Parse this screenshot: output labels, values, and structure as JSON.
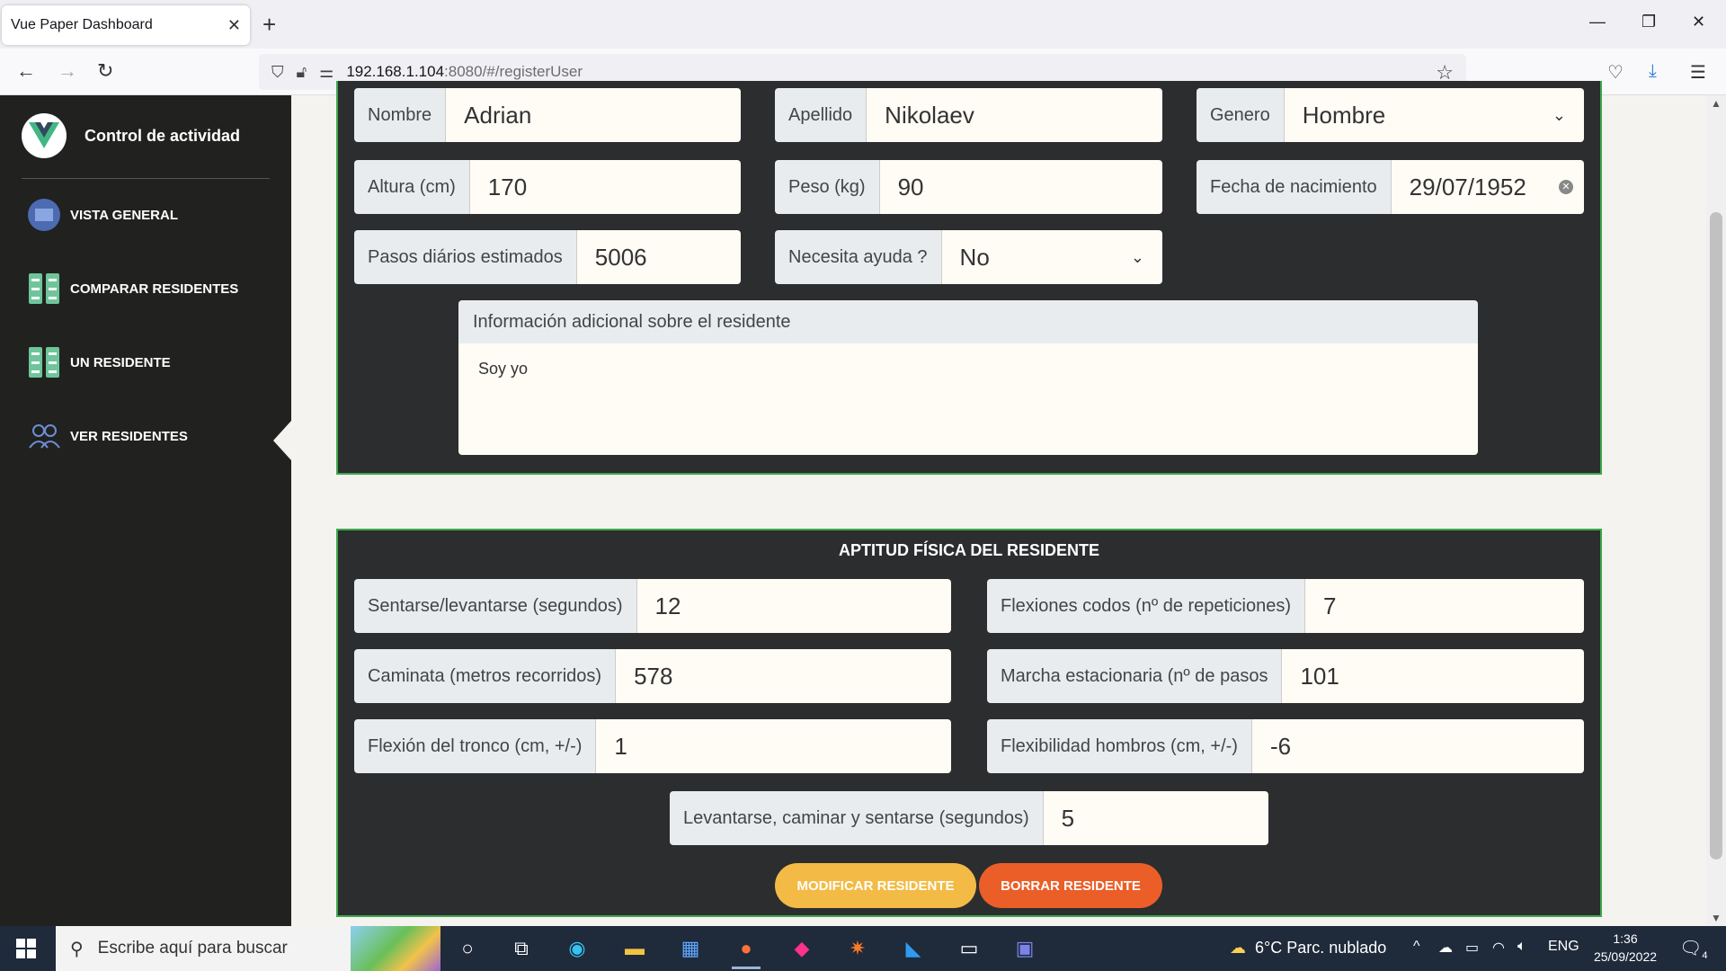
{
  "browser": {
    "tab_title": "Vue Paper Dashboard",
    "url_host": "192.168.1.104",
    "url_rest": ":8080/#/registerUser"
  },
  "sidebar": {
    "brand": "Control de actividad",
    "items": [
      {
        "label": "VISTA GENERAL",
        "icon": "overview-icon"
      },
      {
        "label": "COMPARAR RESIDENTES",
        "icon": "compare-icon"
      },
      {
        "label": "UN RESIDENTE",
        "icon": "checklist-icon"
      },
      {
        "label": "VER RESIDENTES",
        "icon": "users-icon"
      }
    ],
    "active_index": 3
  },
  "personal": {
    "nombre": {
      "label": "Nombre",
      "value": "Adrian"
    },
    "apellido": {
      "label": "Apellido",
      "value": "Nikolaev"
    },
    "genero": {
      "label": "Genero",
      "value": "Hombre"
    },
    "altura": {
      "label": "Altura (cm)",
      "value": "170"
    },
    "peso": {
      "label": "Peso (kg)",
      "value": "90"
    },
    "fecha": {
      "label": "Fecha de nacimiento",
      "value": "29/07/1952"
    },
    "pasos": {
      "label": "Pasos diários estimados",
      "value": "5006"
    },
    "ayuda": {
      "label": "Necesita ayuda ?",
      "value": "No"
    },
    "info_label": "Información adicional sobre el residente",
    "info_value": "Soy yo"
  },
  "fitness": {
    "title": "APTITUD FÍSICA DEL RESIDENTE",
    "sentarse": {
      "label": "Sentarse/levantarse (segundos)",
      "value": "12"
    },
    "flexiones": {
      "label": "Flexiones codos (nº de repeticiones)",
      "value": "7"
    },
    "caminata": {
      "label": "Caminata (metros recorridos)",
      "value": "578"
    },
    "marcha": {
      "label": "Marcha estacionaria (nº de pasos",
      "value": "101"
    },
    "tronco": {
      "label": "Flexión del tronco (cm, +/-)",
      "value": "1"
    },
    "hombros": {
      "label": "Flexibilidad hombros (cm, +/-)",
      "value": "-6"
    },
    "levantarse": {
      "label": "Levantarse, caminar y sentarse (segundos)",
      "value": "5"
    },
    "modify_label": "MODIFICAR RESIDENTE",
    "delete_label": "BORRAR RESIDENTE"
  },
  "taskbar": {
    "search_placeholder": "Escribe aquí para buscar",
    "weather": "6°C  Parc. nublado",
    "lang": "ENG",
    "time": "1:36",
    "date": "25/09/2022",
    "notifications": "4"
  },
  "colors": {
    "sidebar_bg": "#212120",
    "card_bg": "#2c2d2f",
    "card_border": "#3fa74d",
    "btn_modify": "#f3bb45",
    "btn_delete": "#eb5e28"
  }
}
